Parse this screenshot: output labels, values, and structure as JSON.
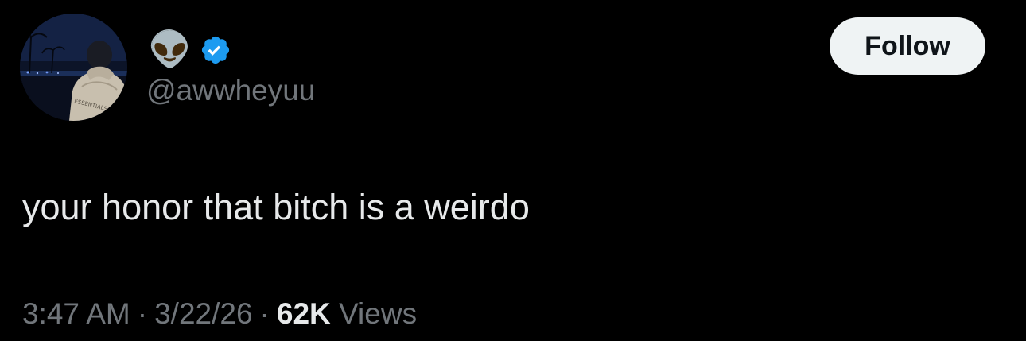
{
  "tweet": {
    "display_name_emoji": "👽",
    "verified": true,
    "handle": "@awwheyuu",
    "follow_label": "Follow",
    "text": "your honor that bitch is a weirdo",
    "time": "3:47 AM",
    "date": "3/22/26",
    "separator": "·",
    "views_count": "62K",
    "views_label": "Views"
  },
  "colors": {
    "background": "#000000",
    "primary_text": "#e7e9ea",
    "secondary_text": "#71767b",
    "verified_badge": "#1d9bf0",
    "follow_button_bg": "#eff3f4",
    "follow_button_text": "#0f1419"
  },
  "icons": {
    "verified": "verified-badge-icon",
    "avatar": "profile-avatar-image"
  }
}
